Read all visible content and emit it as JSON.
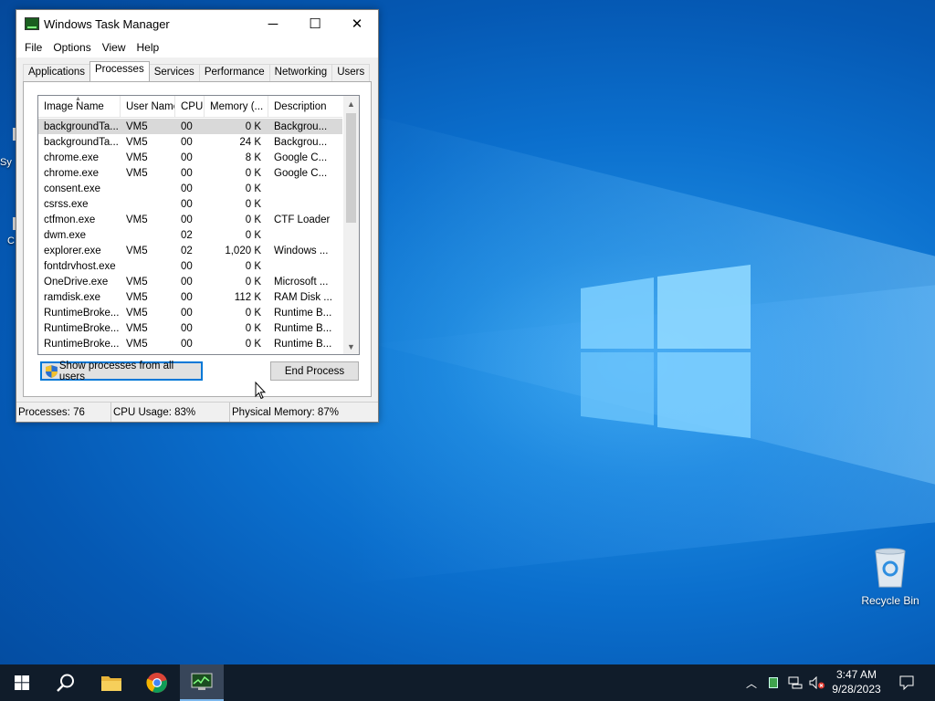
{
  "window": {
    "title": "Windows Task Manager",
    "controls": {
      "minimize": "─",
      "maximize": "☐",
      "close": "✕"
    }
  },
  "menu": [
    "File",
    "Options",
    "View",
    "Help"
  ],
  "tabs": [
    "Applications",
    "Processes",
    "Services",
    "Performance",
    "Networking",
    "Users"
  ],
  "active_tab": "Processes",
  "columns": [
    "Image Name",
    "User Name",
    "CPU",
    "Memory (...",
    "Description"
  ],
  "processes": [
    {
      "name": "backgroundTa...",
      "user": "VM5",
      "cpu": "00",
      "memory": "0 K",
      "description": "Backgrou...",
      "selected": true
    },
    {
      "name": "backgroundTa...",
      "user": "VM5",
      "cpu": "00",
      "memory": "24 K",
      "description": "Backgrou..."
    },
    {
      "name": "chrome.exe",
      "user": "VM5",
      "cpu": "00",
      "memory": "8 K",
      "description": "Google C..."
    },
    {
      "name": "chrome.exe",
      "user": "VM5",
      "cpu": "00",
      "memory": "0 K",
      "description": "Google C..."
    },
    {
      "name": "consent.exe",
      "user": "",
      "cpu": "00",
      "memory": "0 K",
      "description": ""
    },
    {
      "name": "csrss.exe",
      "user": "",
      "cpu": "00",
      "memory": "0 K",
      "description": ""
    },
    {
      "name": "ctfmon.exe",
      "user": "VM5",
      "cpu": "00",
      "memory": "0 K",
      "description": "CTF Loader"
    },
    {
      "name": "dwm.exe",
      "user": "",
      "cpu": "02",
      "memory": "0 K",
      "description": ""
    },
    {
      "name": "explorer.exe",
      "user": "VM5",
      "cpu": "02",
      "memory": "1,020 K",
      "description": "Windows ..."
    },
    {
      "name": "fontdrvhost.exe",
      "user": "",
      "cpu": "00",
      "memory": "0 K",
      "description": ""
    },
    {
      "name": "OneDrive.exe",
      "user": "VM5",
      "cpu": "00",
      "memory": "0 K",
      "description": "Microsoft ..."
    },
    {
      "name": "ramdisk.exe",
      "user": "VM5",
      "cpu": "00",
      "memory": "112 K",
      "description": "RAM Disk ..."
    },
    {
      "name": "RuntimeBroke...",
      "user": "VM5",
      "cpu": "00",
      "memory": "0 K",
      "description": "Runtime B..."
    },
    {
      "name": "RuntimeBroke...",
      "user": "VM5",
      "cpu": "00",
      "memory": "0 K",
      "description": "Runtime B..."
    },
    {
      "name": "RuntimeBroke...",
      "user": "VM5",
      "cpu": "00",
      "memory": "0 K",
      "description": "Runtime B..."
    }
  ],
  "buttons": {
    "show_all": "Show processes from all users",
    "end_process": "End Process"
  },
  "status": {
    "processes": "Processes: 76",
    "cpu": "CPU Usage: 83%",
    "memory": "Physical Memory: 87%"
  },
  "desktop": {
    "recycle_bin": "Recycle Bin",
    "left_stub_1": "Sy",
    "left_stub_2": "C"
  },
  "taskbar": {
    "time": "3:47 AM",
    "date": "9/28/2023"
  },
  "colors": {
    "accent": "#0078d7",
    "taskbar": "#101c2a",
    "selected_row": "#d9d9d9"
  }
}
